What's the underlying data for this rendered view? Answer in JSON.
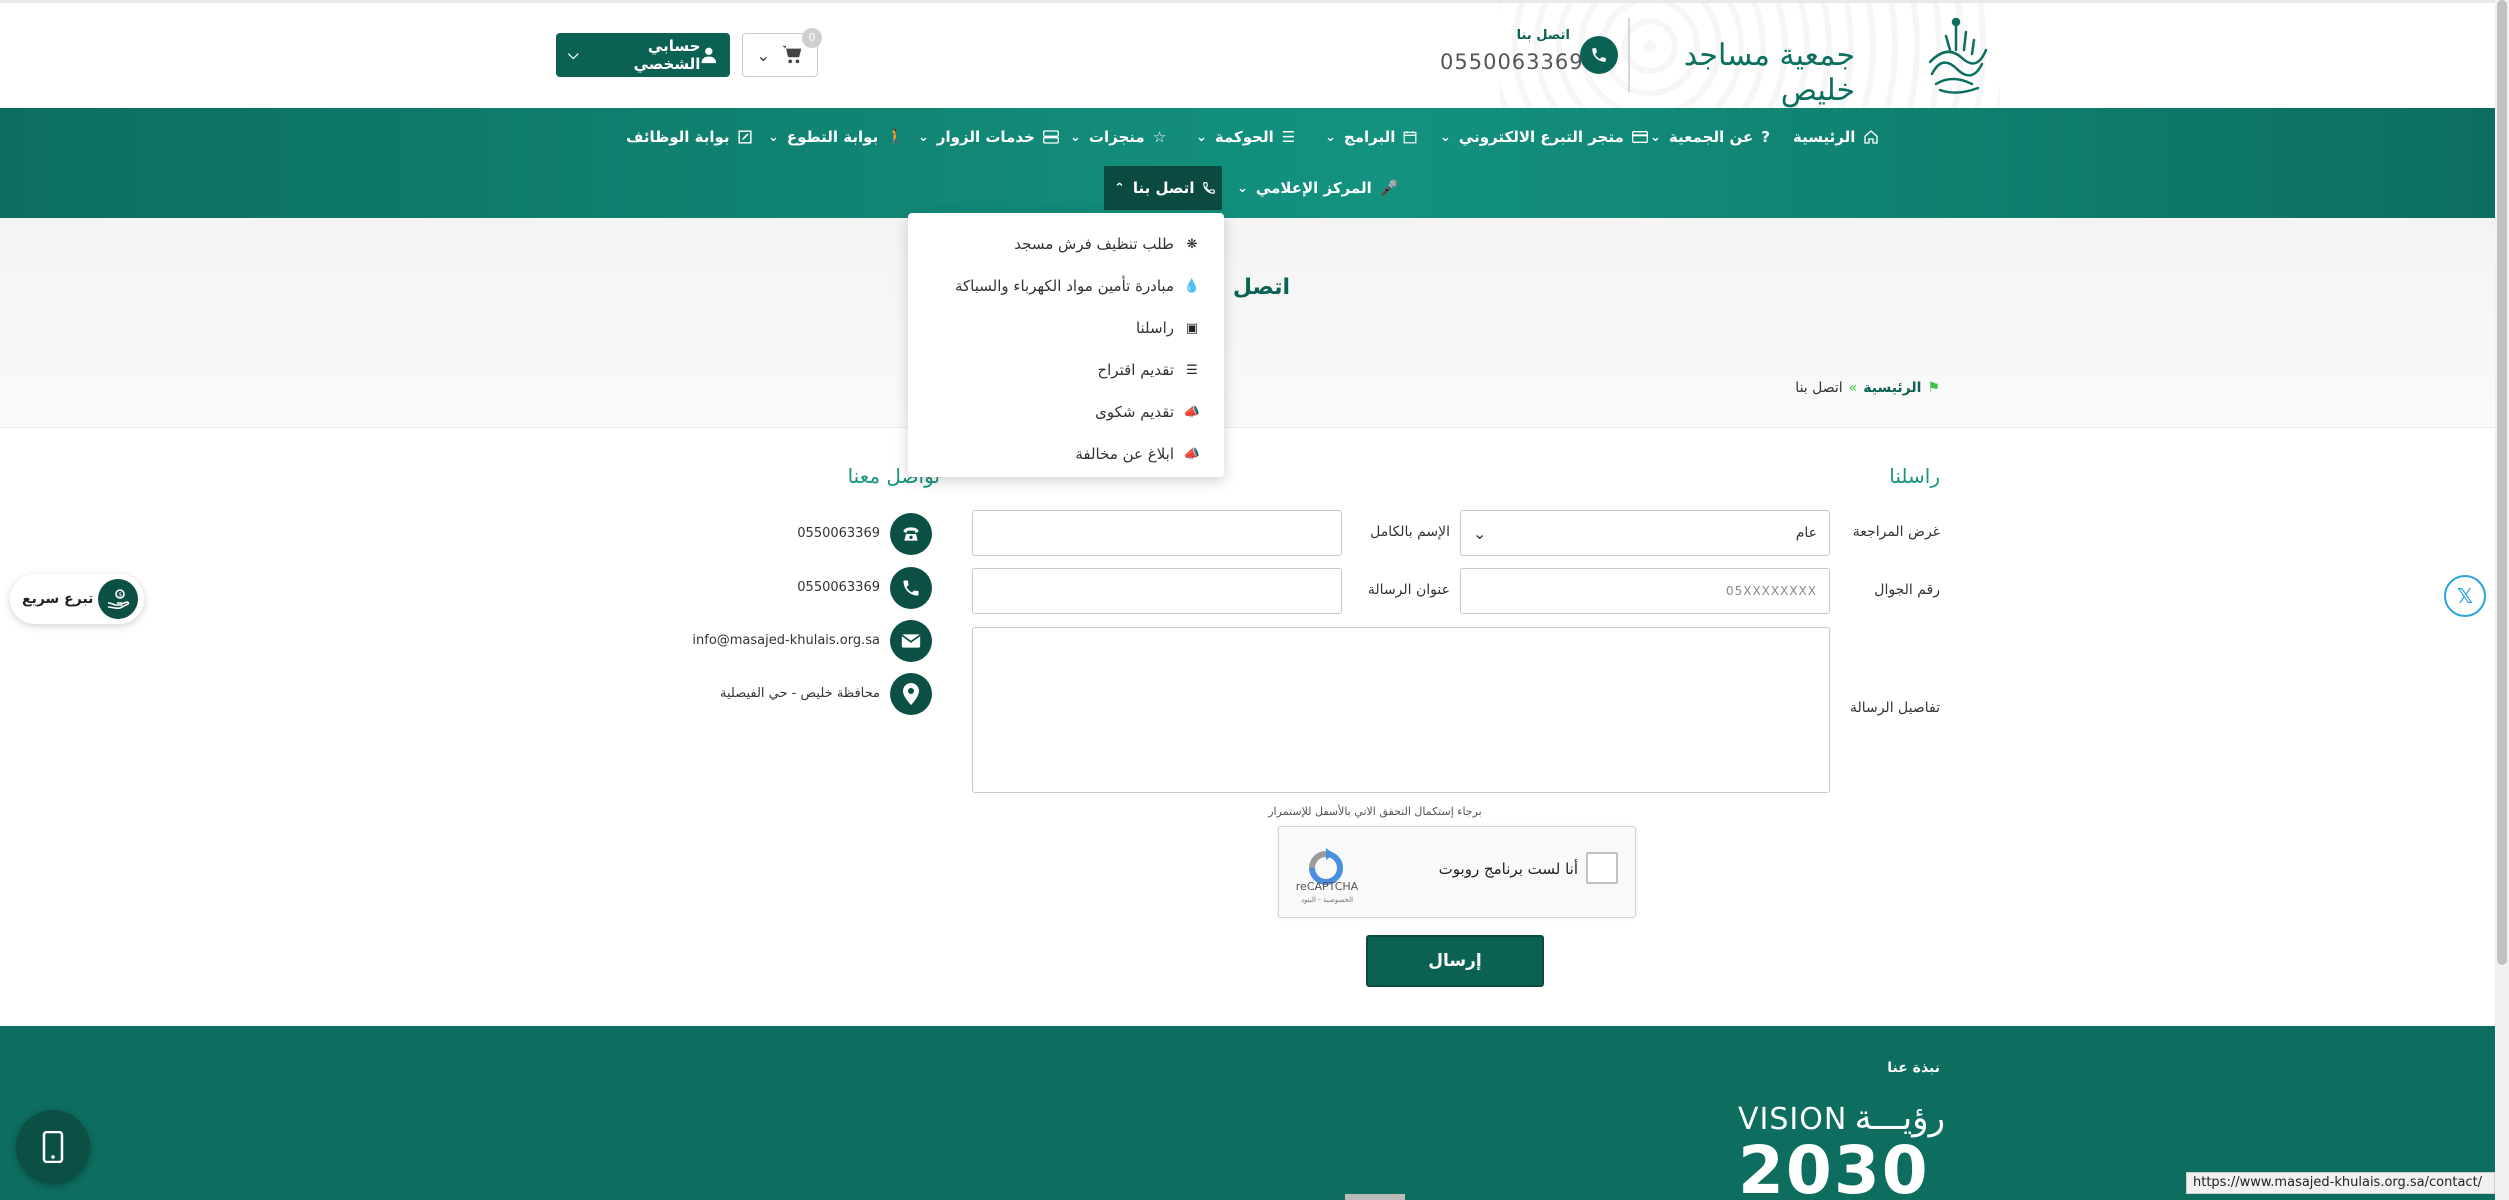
{
  "header": {
    "org_name": "جمعية مساجد خليص",
    "contact_label": "اتصل بنا",
    "contact_phone": "0550063369",
    "cart_count": "0",
    "account_label": "حسابي الشخصي"
  },
  "nav": {
    "items": [
      {
        "label": "الرئيسية"
      },
      {
        "label": "عن الجمعية"
      },
      {
        "label": "متجر التبرع الالكتروني"
      },
      {
        "label": "البرامج"
      },
      {
        "label": "الحوكمة"
      },
      {
        "label": "منجزات"
      },
      {
        "label": "خدمات الزوار"
      },
      {
        "label": "بوابة التطوع"
      },
      {
        "label": "بوابة الوظائف"
      },
      {
        "label": "المركز الإعلامي"
      },
      {
        "label": "اتصل بنا"
      }
    ]
  },
  "dropdown": {
    "items": [
      {
        "label": "طلب تنظيف فرش مسجد",
        "icon": "spinner-icon"
      },
      {
        "label": "مبادرة تأمين مواد الكهرباء والسباكة",
        "icon": "drop-icon"
      },
      {
        "label": "راسلنا",
        "icon": "contact-card-icon"
      },
      {
        "label": "تقديم اقتراح",
        "icon": "list-icon"
      },
      {
        "label": "تقديم شكوى",
        "icon": "megaphone-icon"
      },
      {
        "label": "ابلاغ عن مخالفة",
        "icon": "megaphone-icon"
      }
    ]
  },
  "hero": {
    "title": "اتصل بنا",
    "breadcrumb_home": "الرئيسية",
    "breadcrumb_sep": "»",
    "breadcrumb_current": "اتصل بنا"
  },
  "form": {
    "title": "راسلنا",
    "purpose_label": "غرض المراجعة",
    "purpose_value": "عام",
    "fullname_label": "الإسم بالكامل",
    "mobile_label": "رقم الجوال",
    "mobile_placeholder": "05XXXXXXXX",
    "subject_label": "عنوان الرسالة",
    "details_label": "تفاصيل الرسالة",
    "captcha_note": "برجاء إستكمال التحقق الاتي بالأسفل للإستمرار",
    "captcha_label": "أنا لست برنامج روبوت",
    "captcha_brand": "reCAPTCHA",
    "captcha_terms": "الخصوصية - البنود",
    "send_label": "إرسال"
  },
  "contact": {
    "title": "تواصل معنا",
    "items": [
      {
        "text": "0550063369",
        "icon": "telephone-icon"
      },
      {
        "text": "0550063369",
        "icon": "phone-icon"
      },
      {
        "text": "info@masajed-khulais.org.sa",
        "icon": "envelope-icon"
      },
      {
        "text": "محافظة خليص - حي الفيصلية",
        "icon": "location-pin-icon"
      }
    ]
  },
  "widgets": {
    "quick_donate": "تبرع سريع"
  },
  "footer": {
    "about": "نبذة عنا",
    "vision_en": "VISION",
    "vision_ar": "رؤيـــة",
    "vision_year": "2030"
  },
  "status_url": "https://www.masajed-khulais.org.sa/contact/",
  "colors": {
    "primary": "#0b6153",
    "nav": "#139280",
    "accent": "#17977f"
  }
}
